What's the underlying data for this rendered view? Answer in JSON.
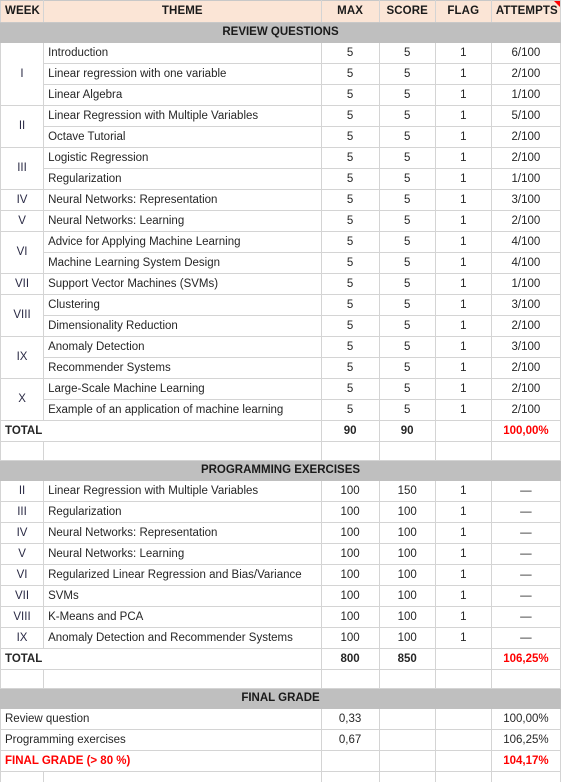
{
  "colors": {
    "header_bg": "#fbe5d6",
    "section_bg": "#bfbfbf",
    "highlight_bg": "#ffff00",
    "highlight_text": "#ff0000",
    "grid_line": "#d4d4d4",
    "comment_marker": "#ff0000"
  },
  "header": {
    "week": "WEEK",
    "theme": "THEME",
    "max": "MAX",
    "score": "SCORE",
    "flag": "FLAG",
    "attempts": "ATTEMPTS",
    "comment_icon": "comment-marker-icon"
  },
  "sections": {
    "review": {
      "banner": "REVIEW QUESTIONS",
      "rows": [
        {
          "week": "",
          "theme": "Introduction",
          "max": "5",
          "score": "5",
          "flag": "1",
          "attempts": "6/100"
        },
        {
          "week": "I",
          "theme": "Linear regression with one variable",
          "max": "5",
          "score": "5",
          "flag": "1",
          "attempts": "2/100"
        },
        {
          "week": "",
          "theme": "Linear Algebra",
          "max": "5",
          "score": "5",
          "flag": "1",
          "attempts": "1/100"
        },
        {
          "week": "II",
          "theme": "Linear Regression with Multiple Variables",
          "max": "5",
          "score": "5",
          "flag": "1",
          "attempts": "5/100"
        },
        {
          "week": "",
          "theme": "Octave Tutorial",
          "max": "5",
          "score": "5",
          "flag": "1",
          "attempts": "2/100"
        },
        {
          "week": "III",
          "theme": "Logistic Regression",
          "max": "5",
          "score": "5",
          "flag": "1",
          "attempts": "2/100"
        },
        {
          "week": "",
          "theme": "Regularization",
          "max": "5",
          "score": "5",
          "flag": "1",
          "attempts": "1/100"
        },
        {
          "week": "IV",
          "theme": "Neural Networks: Representation",
          "max": "5",
          "score": "5",
          "flag": "1",
          "attempts": "3/100"
        },
        {
          "week": "V",
          "theme": "Neural Networks: Learning",
          "max": "5",
          "score": "5",
          "flag": "1",
          "attempts": "2/100"
        },
        {
          "week": "VI",
          "theme": "Advice for Applying Machine Learning",
          "max": "5",
          "score": "5",
          "flag": "1",
          "attempts": "4/100"
        },
        {
          "week": "",
          "theme": "Machine Learning System Design",
          "max": "5",
          "score": "5",
          "flag": "1",
          "attempts": "4/100"
        },
        {
          "week": "VII",
          "theme": "Support Vector Machines (SVMs)",
          "max": "5",
          "score": "5",
          "flag": "1",
          "attempts": "1/100"
        },
        {
          "week": "VIII",
          "theme": "Clustering",
          "max": "5",
          "score": "5",
          "flag": "1",
          "attempts": "3/100"
        },
        {
          "week": "",
          "theme": "Dimensionality Reduction",
          "max": "5",
          "score": "5",
          "flag": "1",
          "attempts": "2/100"
        },
        {
          "week": "IX",
          "theme": "Anomaly Detection",
          "max": "5",
          "score": "5",
          "flag": "1",
          "attempts": "3/100"
        },
        {
          "week": "",
          "theme": "Recommender Systems",
          "max": "5",
          "score": "5",
          "flag": "1",
          "attempts": "2/100"
        },
        {
          "week": "X",
          "theme": "Large-Scale Machine Learning",
          "max": "5",
          "score": "5",
          "flag": "1",
          "attempts": "2/100"
        },
        {
          "week": "",
          "theme": "Example of an application of machine learning",
          "max": "5",
          "score": "5",
          "flag": "1",
          "attempts": "2/100"
        }
      ],
      "total": {
        "label": "TOTAL",
        "max": "90",
        "score": "90",
        "flag": "",
        "attempts": "100,00%"
      }
    },
    "programming": {
      "banner": "PROGRAMMING EXERCISES",
      "rows": [
        {
          "week": "II",
          "theme": "Linear Regression with Multiple Variables",
          "max": "100",
          "score": "150",
          "flag": "1",
          "attempts": "—"
        },
        {
          "week": "III",
          "theme": "Regularization",
          "max": "100",
          "score": "100",
          "flag": "1",
          "attempts": "—"
        },
        {
          "week": "IV",
          "theme": "Neural Networks: Representation",
          "max": "100",
          "score": "100",
          "flag": "1",
          "attempts": "—"
        },
        {
          "week": "V",
          "theme": "Neural Networks: Learning",
          "max": "100",
          "score": "100",
          "flag": "1",
          "attempts": "—"
        },
        {
          "week": "VI",
          "theme": "Regularized Linear Regression and Bias/Variance",
          "max": "100",
          "score": "100",
          "flag": "1",
          "attempts": "—"
        },
        {
          "week": "VII",
          "theme": "SVMs",
          "max": "100",
          "score": "100",
          "flag": "1",
          "attempts": "—"
        },
        {
          "week": "VIII",
          "theme": "K-Means and PCA",
          "max": "100",
          "score": "100",
          "flag": "1",
          "attempts": "—"
        },
        {
          "week": "IX",
          "theme": "Anomaly Detection and Recommender Systems",
          "max": "100",
          "score": "100",
          "flag": "1",
          "attempts": "—"
        }
      ],
      "total": {
        "label": "TOTAL",
        "max": "800",
        "score": "850",
        "flag": "",
        "attempts": "106,25%"
      }
    },
    "final": {
      "banner": "FINAL GRADE",
      "rows": [
        {
          "label": "Review question",
          "weight": "0,33",
          "flag": "",
          "result": "100,00%"
        },
        {
          "label": "Programming exercises",
          "weight": "0,67",
          "flag": "",
          "result": "106,25%"
        }
      ],
      "final_row": {
        "label": "FINAL GRADE (> 80 %)",
        "weight": "",
        "flag": "",
        "result": "104,17%"
      }
    }
  }
}
